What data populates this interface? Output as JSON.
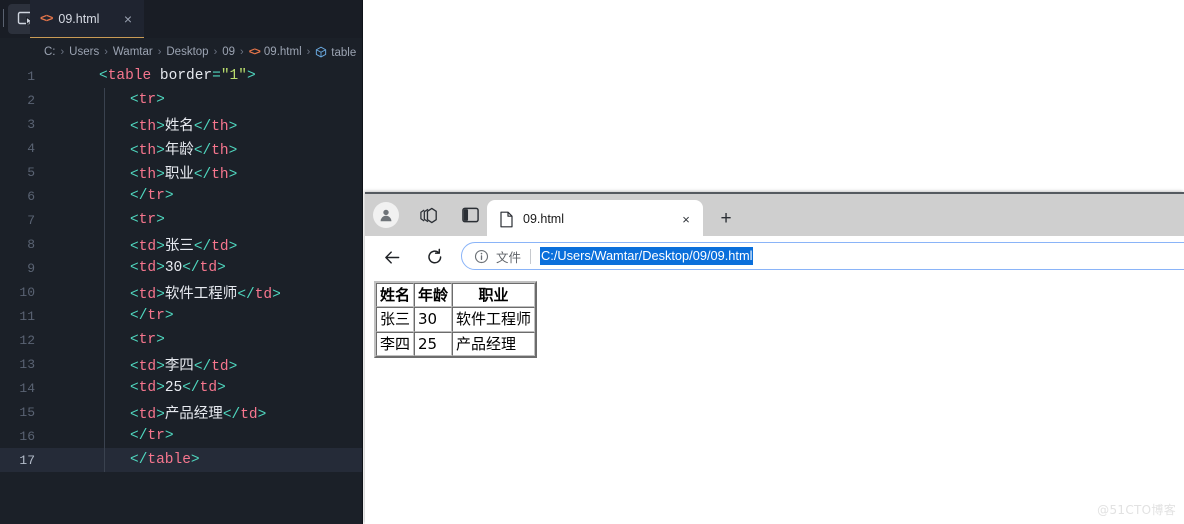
{
  "editor": {
    "tab": {
      "label": "09.html",
      "icon": "html-file-icon",
      "close_icon": "×"
    },
    "screencast_icon": "screencast-mode-icon",
    "breadcrumb": {
      "separator": "›",
      "items": [
        {
          "label": "C:",
          "icon": null
        },
        {
          "label": "Users",
          "icon": null
        },
        {
          "label": "Wamtar",
          "icon": null
        },
        {
          "label": "Desktop",
          "icon": null
        },
        {
          "label": "09",
          "icon": null
        },
        {
          "label": "09.html",
          "icon": "html-file-icon"
        },
        {
          "label": "table",
          "icon": "symbol-tag-icon"
        }
      ]
    },
    "lines": [
      {
        "n": "1",
        "indent": 0,
        "active": false,
        "tokens": [
          {
            "t": "<",
            "c": "pk"
          },
          {
            "t": "table",
            "c": "tg"
          },
          {
            "t": " ",
            "c": "at"
          },
          {
            "t": "border",
            "c": "at"
          },
          {
            "t": "=",
            "c": "pk"
          },
          {
            "t": "\"1\"",
            "c": "st"
          },
          {
            "t": ">",
            "c": "pk"
          }
        ]
      },
      {
        "n": "2",
        "indent": 1,
        "active": false,
        "tokens": [
          {
            "t": "<",
            "c": "pk"
          },
          {
            "t": "tr",
            "c": "tg"
          },
          {
            "t": ">",
            "c": "pk"
          }
        ]
      },
      {
        "n": "3",
        "indent": 1,
        "active": false,
        "tokens": [
          {
            "t": "<",
            "c": "pk"
          },
          {
            "t": "th",
            "c": "tg"
          },
          {
            "t": ">",
            "c": "pk"
          },
          {
            "t": "姓名",
            "c": "tx"
          },
          {
            "t": "</",
            "c": "pk"
          },
          {
            "t": "th",
            "c": "tg"
          },
          {
            "t": ">",
            "c": "pk"
          }
        ]
      },
      {
        "n": "4",
        "indent": 1,
        "active": false,
        "tokens": [
          {
            "t": "<",
            "c": "pk"
          },
          {
            "t": "th",
            "c": "tg"
          },
          {
            "t": ">",
            "c": "pk"
          },
          {
            "t": "年龄",
            "c": "tx"
          },
          {
            "t": "</",
            "c": "pk"
          },
          {
            "t": "th",
            "c": "tg"
          },
          {
            "t": ">",
            "c": "pk"
          }
        ]
      },
      {
        "n": "5",
        "indent": 1,
        "active": false,
        "tokens": [
          {
            "t": "<",
            "c": "pk"
          },
          {
            "t": "th",
            "c": "tg"
          },
          {
            "t": ">",
            "c": "pk"
          },
          {
            "t": "职业",
            "c": "tx"
          },
          {
            "t": "</",
            "c": "pk"
          },
          {
            "t": "th",
            "c": "tg"
          },
          {
            "t": ">",
            "c": "pk"
          }
        ]
      },
      {
        "n": "6",
        "indent": 1,
        "active": false,
        "tokens": [
          {
            "t": "</",
            "c": "pk"
          },
          {
            "t": "tr",
            "c": "tg"
          },
          {
            "t": ">",
            "c": "pk"
          }
        ]
      },
      {
        "n": "7",
        "indent": 1,
        "active": false,
        "tokens": [
          {
            "t": "<",
            "c": "pk"
          },
          {
            "t": "tr",
            "c": "tg"
          },
          {
            "t": ">",
            "c": "pk"
          }
        ]
      },
      {
        "n": "8",
        "indent": 1,
        "active": false,
        "tokens": [
          {
            "t": "<",
            "c": "pk"
          },
          {
            "t": "td",
            "c": "tg"
          },
          {
            "t": ">",
            "c": "pk"
          },
          {
            "t": "张三",
            "c": "tx"
          },
          {
            "t": "</",
            "c": "pk"
          },
          {
            "t": "td",
            "c": "tg"
          },
          {
            "t": ">",
            "c": "pk"
          }
        ]
      },
      {
        "n": "9",
        "indent": 1,
        "active": false,
        "tokens": [
          {
            "t": "<",
            "c": "pk"
          },
          {
            "t": "td",
            "c": "tg"
          },
          {
            "t": ">",
            "c": "pk"
          },
          {
            "t": "30",
            "c": "nm"
          },
          {
            "t": "</",
            "c": "pk"
          },
          {
            "t": "td",
            "c": "tg"
          },
          {
            "t": ">",
            "c": "pk"
          }
        ]
      },
      {
        "n": "10",
        "indent": 1,
        "active": false,
        "tokens": [
          {
            "t": "<",
            "c": "pk"
          },
          {
            "t": "td",
            "c": "tg"
          },
          {
            "t": ">",
            "c": "pk"
          },
          {
            "t": "软件工程师",
            "c": "tx"
          },
          {
            "t": "</",
            "c": "pk"
          },
          {
            "t": "td",
            "c": "tg"
          },
          {
            "t": ">",
            "c": "pk"
          }
        ]
      },
      {
        "n": "11",
        "indent": 1,
        "active": false,
        "tokens": [
          {
            "t": "</",
            "c": "pk"
          },
          {
            "t": "tr",
            "c": "tg"
          },
          {
            "t": ">",
            "c": "pk"
          }
        ]
      },
      {
        "n": "12",
        "indent": 1,
        "active": false,
        "tokens": [
          {
            "t": "<",
            "c": "pk"
          },
          {
            "t": "tr",
            "c": "tg"
          },
          {
            "t": ">",
            "c": "pk"
          }
        ]
      },
      {
        "n": "13",
        "indent": 1,
        "active": false,
        "tokens": [
          {
            "t": "<",
            "c": "pk"
          },
          {
            "t": "td",
            "c": "tg"
          },
          {
            "t": ">",
            "c": "pk"
          },
          {
            "t": "李四",
            "c": "tx"
          },
          {
            "t": "</",
            "c": "pk"
          },
          {
            "t": "td",
            "c": "tg"
          },
          {
            "t": ">",
            "c": "pk"
          }
        ]
      },
      {
        "n": "14",
        "indent": 1,
        "active": false,
        "tokens": [
          {
            "t": "<",
            "c": "pk"
          },
          {
            "t": "td",
            "c": "tg"
          },
          {
            "t": ">",
            "c": "pk"
          },
          {
            "t": "25",
            "c": "nm"
          },
          {
            "t": "</",
            "c": "pk"
          },
          {
            "t": "td",
            "c": "tg"
          },
          {
            "t": ">",
            "c": "pk"
          }
        ]
      },
      {
        "n": "15",
        "indent": 1,
        "active": false,
        "tokens": [
          {
            "t": "<",
            "c": "pk"
          },
          {
            "t": "td",
            "c": "tg"
          },
          {
            "t": ">",
            "c": "pk"
          },
          {
            "t": "产品经理",
            "c": "tx"
          },
          {
            "t": "</",
            "c": "pk"
          },
          {
            "t": "td",
            "c": "tg"
          },
          {
            "t": ">",
            "c": "pk"
          }
        ]
      },
      {
        "n": "16",
        "indent": 1,
        "active": false,
        "tokens": [
          {
            "t": "</",
            "c": "pk"
          },
          {
            "t": "tr",
            "c": "tg"
          },
          {
            "t": ">",
            "c": "pk"
          }
        ]
      },
      {
        "n": "17",
        "indent": 1,
        "active": true,
        "tokens": [
          {
            "t": "</",
            "c": "pk"
          },
          {
            "t": "table",
            "c": "tg"
          },
          {
            "t": ">",
            "c": "pk"
          }
        ]
      }
    ],
    "colors": {
      "background": "#1b2028",
      "tab_background": "#1f2430",
      "active_line": "#252b38",
      "tag": "#f7768e",
      "punctuation": "#4fd6be",
      "string": "#b9dd6d",
      "text": "#e8ebf1",
      "line_number": "#5a6373",
      "tab_accent": "#c99b55",
      "html_icon": "#e8764a"
    }
  },
  "browser": {
    "profile_icon": "account-avatar-icon",
    "collections_icon": "tab-groups-icon",
    "split_icon": "split-screen-icon",
    "tab": {
      "favicon": "page-file-icon",
      "title": "09.html",
      "close_icon": "×"
    },
    "new_tab_icon": "+",
    "nav": {
      "back_icon": "back-arrow-icon",
      "reload_icon": "reload-icon"
    },
    "omnibox": {
      "info_icon": "info-circle-icon",
      "file_label": "文件",
      "divider": "|",
      "url": "C:/Users/Wamtar/Desktop/09/09.html",
      "url_selected": true,
      "selection_color": "#0a6fdb",
      "border_color": "#8ab4f8"
    },
    "colors": {
      "titlebar": "#cfcfcf",
      "toolbar": "#ffffff",
      "content": "#ffffff"
    }
  },
  "rendered_table": {
    "headers": [
      "姓名",
      "年龄",
      "职业"
    ],
    "rows": [
      [
        "张三",
        "30",
        "软件工程师"
      ],
      [
        "李四",
        "25",
        "产品经理"
      ]
    ]
  },
  "watermark": {
    "text": "@51CTO博客"
  }
}
